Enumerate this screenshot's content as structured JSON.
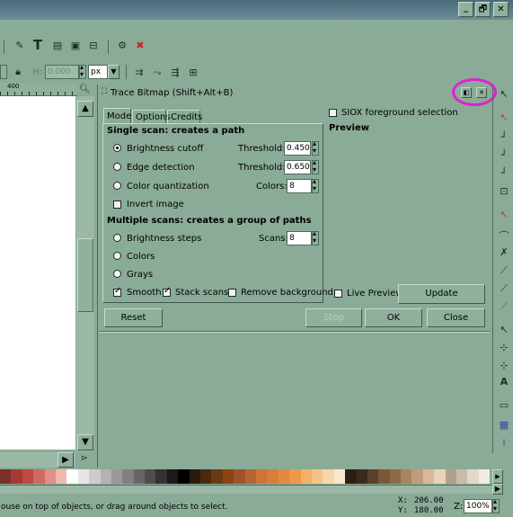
{
  "window_controls": {
    "minimize": "_",
    "restore": "🗗",
    "close": "✕"
  },
  "toolbar2": {
    "h_label": "H:",
    "h_value": "0.000",
    "unit": "px"
  },
  "ruler": {
    "tick_label": "400"
  },
  "dialog": {
    "title": "Trace Bitmap (Shift+Alt+B)",
    "tabs": [
      "Mode",
      "Options",
      "Credits"
    ],
    "single_scan_header": "Single scan: creates a path",
    "brightness_cutoff": "Brightness cutoff",
    "threshold_label": "Threshold:",
    "brightness_threshold": "0.450",
    "edge_detection": "Edge detection",
    "edge_threshold": "0.650",
    "color_quantization": "Color quantization",
    "colors_label": "Colors:",
    "colors_value": "8",
    "invert_image": "Invert image",
    "multiple_scans_header": "Multiple scans: creates a group of paths",
    "brightness_steps": "Brightness steps",
    "scans_label": "Scans:",
    "scans_value": "8",
    "colors_option": "Colors",
    "grays_option": "Grays",
    "smooth": "Smooth",
    "stack_scans": "Stack scans",
    "remove_background": "Remove background",
    "siox": "SIOX foreground selection",
    "preview": "Preview",
    "live_preview": "Live Preview",
    "update": "Update",
    "reset": "Reset",
    "stop": "Stop",
    "ok": "OK",
    "close": "Close"
  },
  "status": {
    "message": "ouse on top of objects, or drag around objects to select.",
    "x_label": "X:",
    "x_value": "206.00",
    "y_label": "Y:",
    "y_value": "180.00",
    "zoom_label": "Z:",
    "zoom_value": "100%"
  },
  "colors": {
    "highlight": "#e020d0",
    "palette": [
      "#7a2f2a",
      "#a33a34",
      "#c04a40",
      "#d06a60",
      "#e09088",
      "#f0b8b0",
      "#ffffff",
      "#e6e6e6",
      "#cccccc",
      "#b3b3b3",
      "#999999",
      "#808080",
      "#666666",
      "#4d4d4d",
      "#333333",
      "#1a1a1a",
      "#000000",
      "#2b1a0e",
      "#4a2a10",
      "#6b3a12",
      "#8b4513",
      "#a0522d",
      "#b8632f",
      "#cd7438",
      "#d97f3a",
      "#e38a3c",
      "#ec9a48",
      "#f2b06a",
      "#f5c28a",
      "#f8d6ae",
      "#fae6cc",
      "#2b2015",
      "#3b2b1c",
      "#5a4029",
      "#7a5738",
      "#8f6a48",
      "#a88360",
      "#c09c7c",
      "#d8b898",
      "#e8d2b8",
      "#b0a090",
      "#c8bca8",
      "#e0d8c8",
      "#f0ece0"
    ]
  }
}
